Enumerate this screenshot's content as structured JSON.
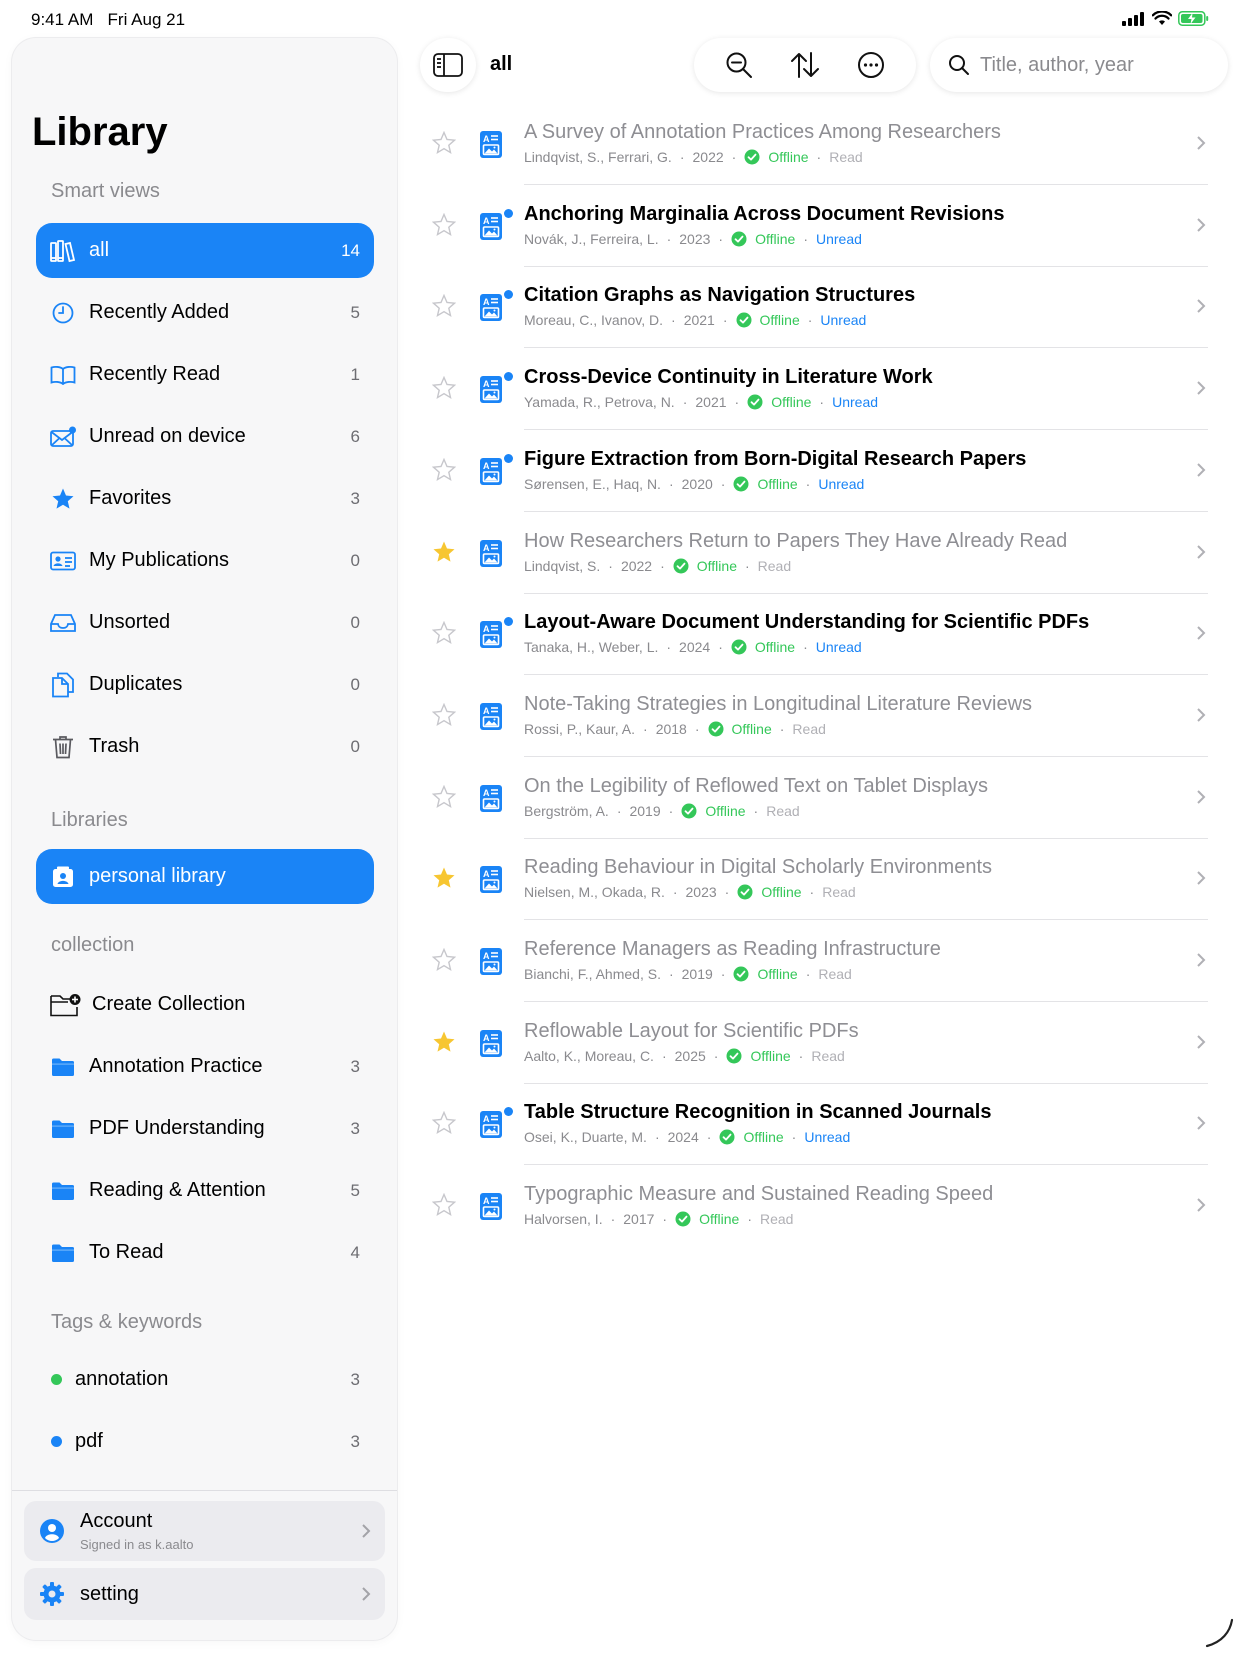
{
  "status_bar": {
    "time": "9:41 AM",
    "date": "Fri Aug 21"
  },
  "sidebar": {
    "title": "Library",
    "smart_views_header": "Smart views",
    "smart_views": [
      {
        "label": "all",
        "count": "14",
        "icon": "library-icon",
        "active": true
      },
      {
        "label": "Recently Added",
        "count": "5",
        "icon": "clock-icon"
      },
      {
        "label": "Recently Read",
        "count": "1",
        "icon": "book-icon"
      },
      {
        "label": "Unread on device",
        "count": "6",
        "icon": "unread-mail-icon"
      },
      {
        "label": "Favorites",
        "count": "3",
        "icon": "star-icon"
      },
      {
        "label": "My Publications",
        "count": "0",
        "icon": "id-card-icon"
      },
      {
        "label": "Unsorted",
        "count": "0",
        "icon": "tray-icon"
      },
      {
        "label": "Duplicates",
        "count": "0",
        "icon": "duplicate-icon"
      },
      {
        "label": "Trash",
        "count": "0",
        "icon": "trash-icon"
      }
    ],
    "libraries_header": "Libraries",
    "libraries": [
      {
        "label": "personal library",
        "icon": "person-library-icon",
        "active": true
      }
    ],
    "collection_header": "collection",
    "create_collection_label": "Create Collection",
    "collections": [
      {
        "label": "Annotation Practice",
        "count": "3"
      },
      {
        "label": "PDF Understanding",
        "count": "3"
      },
      {
        "label": "Reading & Attention",
        "count": "5"
      },
      {
        "label": "To Read",
        "count": "4"
      }
    ],
    "tags_header": "Tags & keywords",
    "tags": [
      {
        "label": "annotation",
        "count": "3",
        "color": "#34c759"
      },
      {
        "label": "pdf",
        "count": "3",
        "color": "#1a84f6"
      }
    ],
    "account": {
      "title": "Account",
      "subtitle": "Signed in as k.aalto"
    },
    "settings": {
      "label": "setting"
    }
  },
  "toolbar": {
    "view_title": "all",
    "search_placeholder": "Title, author, year"
  },
  "papers": [
    {
      "title": "A Survey of Annotation Practices Among Researchers",
      "authors": "Lindqvist, S., Ferrari, G.",
      "year": "2022",
      "offline": "Offline",
      "status": "Read",
      "starred": false,
      "unread": false
    },
    {
      "title": "Anchoring Marginalia Across Document Revisions",
      "authors": "Novák, J., Ferreira, L.",
      "year": "2023",
      "offline": "Offline",
      "status": "Unread",
      "starred": false,
      "unread": true
    },
    {
      "title": "Citation Graphs as Navigation Structures",
      "authors": "Moreau, C., Ivanov, D.",
      "year": "2021",
      "offline": "Offline",
      "status": "Unread",
      "starred": false,
      "unread": true
    },
    {
      "title": "Cross-Device Continuity in Literature Work",
      "authors": "Yamada, R., Petrova, N.",
      "year": "2021",
      "offline": "Offline",
      "status": "Unread",
      "starred": false,
      "unread": true
    },
    {
      "title": "Figure Extraction from Born-Digital Research Papers",
      "authors": "Sørensen, E., Haq, N.",
      "year": "2020",
      "offline": "Offline",
      "status": "Unread",
      "starred": false,
      "unread": true
    },
    {
      "title": "How Researchers Return to Papers They Have Already Read",
      "authors": "Lindqvist, S.",
      "year": "2022",
      "offline": "Offline",
      "status": "Read",
      "starred": true,
      "unread": false
    },
    {
      "title": "Layout-Aware Document Understanding for Scientific PDFs",
      "authors": "Tanaka, H., Weber, L.",
      "year": "2024",
      "offline": "Offline",
      "status": "Unread",
      "starred": false,
      "unread": true
    },
    {
      "title": "Note-Taking Strategies in Longitudinal Literature Reviews",
      "authors": "Rossi, P., Kaur, A.",
      "year": "2018",
      "offline": "Offline",
      "status": "Read",
      "starred": false,
      "unread": false
    },
    {
      "title": "On the Legibility of Reflowed Text on Tablet Displays",
      "authors": "Bergström, A.",
      "year": "2019",
      "offline": "Offline",
      "status": "Read",
      "starred": false,
      "unread": false
    },
    {
      "title": "Reading Behaviour in Digital Scholarly Environments",
      "authors": "Nielsen, M., Okada, R.",
      "year": "2023",
      "offline": "Offline",
      "status": "Read",
      "starred": true,
      "unread": false
    },
    {
      "title": "Reference Managers as Reading Infrastructure",
      "authors": "Bianchi, F., Ahmed, S.",
      "year": "2019",
      "offline": "Offline",
      "status": "Read",
      "starred": false,
      "unread": false
    },
    {
      "title": "Reflowable Layout for Scientific PDFs",
      "authors": "Aalto, K., Moreau, C.",
      "year": "2025",
      "offline": "Offline",
      "status": "Read",
      "starred": true,
      "unread": false
    },
    {
      "title": "Table Structure Recognition in Scanned Journals",
      "authors": "Osei, K., Duarte, M.",
      "year": "2024",
      "offline": "Offline",
      "status": "Unread",
      "starred": false,
      "unread": true
    },
    {
      "title": "Typographic Measure and Sustained Reading Speed",
      "authors": "Halvorsen, I.",
      "year": "2017",
      "offline": "Offline",
      "status": "Read",
      "starred": false,
      "unread": false
    }
  ],
  "colors": {
    "accent": "#1a84f6",
    "offline": "#34c759",
    "favorite": "#f7c631"
  }
}
